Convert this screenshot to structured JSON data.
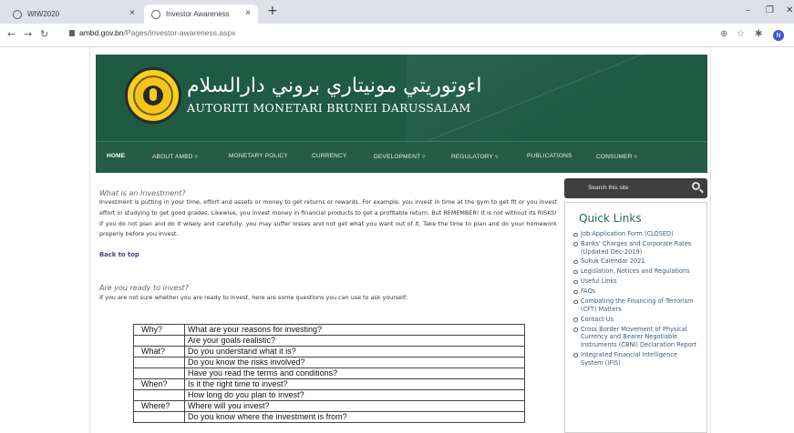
{
  "browser": {
    "tabs": [
      {
        "label": "WIW2020"
      },
      {
        "label": "Investor Awareness"
      }
    ],
    "new_tab": "+",
    "url_domain": "ambd.gov.bn",
    "url_path": "/Pages/investor-awareness.aspx",
    "profile_initial": "N"
  },
  "header": {
    "arabic_title": "اءوتوريتي مونيتاري بروني دارالسلام",
    "latin_title": "AUTORITI MONETARI BRUNEI DARUSSALAM"
  },
  "nav": [
    {
      "label": "HOME"
    },
    {
      "label": "ABOUT AMBD ▿"
    },
    {
      "label": "MONETARY POLICY"
    },
    {
      "label": "CURRENCY"
    },
    {
      "label": "DEVELOPMENT ▿"
    },
    {
      "label": "REGULATORY ▿"
    },
    {
      "label": "PUBLICATIONS"
    },
    {
      "label": "CONSUMER ▿"
    }
  ],
  "content": {
    "what_heading": "What is an Investment?",
    "what_paragraph": "Investment is putting in your time, effort and assets or money to get returns or rewards. For example, you invest in time at the gym to get fit or you invest effort in studying to get good grades. Likewise, you invest money in financial products to get a profitable return. But REMEMBER! It is not without its RISKS! If you do not plan and do it wisely and carefully, you may suffer losses and not get what you want out of it. Take the time to plan and do your homework properly before you invest.",
    "back_to_top": "Back to top",
    "ready_heading": "Are you ready to invest?",
    "ready_paragraph": "If you are not sure whether you are ready to invest, here are some questions you can use to ask yourself:",
    "questions": [
      {
        "key": "Why?",
        "question": "What are your reasons for investing?"
      },
      {
        "key": "",
        "question": "Are your goals realistic?"
      },
      {
        "key": "What?",
        "question": "Do you understand what it is?"
      },
      {
        "key": "",
        "question": "Do you know the risks involved?"
      },
      {
        "key": "",
        "question": "Have you read the terms and conditions?"
      },
      {
        "key": "When?",
        "question": "Is it the right time to invest?"
      },
      {
        "key": "",
        "question": "How long do you plan to invest?"
      },
      {
        "key": "Where?",
        "question": "Where will you invest?"
      },
      {
        "key": "",
        "question": "Do you know where the investment is from?"
      }
    ]
  },
  "sidebar": {
    "search_placeholder": "Search this site",
    "quick_links_title": "Quick Links",
    "links": [
      "Job Application Form (CLOSED)",
      "Banks' Charges and Corporate Rates (Updated Dec-2019)",
      "Sukuk Calendar 2021",
      "Legislation, Notices and Regulations",
      "Useful Links",
      "FAQs",
      "Combating the Financing of Terrorism (CFT) Matters",
      "Contact Us",
      "Cross Border Movement of Physical Currency and Bearer Negotiable Instruments (CBNI) Declaration Report",
      "Integrated Financial Intelligence System (IFIS)"
    ]
  }
}
